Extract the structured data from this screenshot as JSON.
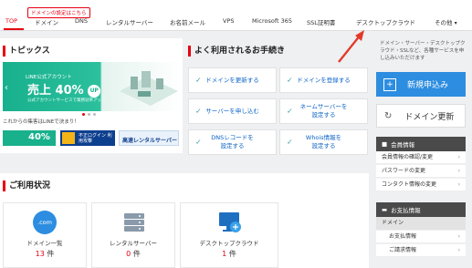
{
  "header": {
    "tooltip": "ドメインの設定はこちら",
    "nav": [
      {
        "label": "TOP"
      },
      {
        "label": "ドメイン"
      },
      {
        "label": "DNS"
      },
      {
        "label": "レンタルサーバー"
      },
      {
        "label": "お名前メール"
      },
      {
        "label": "VPS"
      },
      {
        "label": "Microsoft 365"
      },
      {
        "label": "SSL証明書"
      },
      {
        "label": "デスクトップクラウド"
      },
      {
        "label": "その他"
      }
    ],
    "active_index": 0
  },
  "topics": {
    "title": "トピックス",
    "banner": {
      "small": "LINE公式アカウント",
      "big_prefix": "売上",
      "big_value": "40%",
      "up": "UP",
      "sub": "公式アカウントサービスで業務効率アップ"
    },
    "caption": "これからの集客はLINEで決まり！",
    "mini_banners": [
      {
        "text": "40%"
      },
      {
        "text": "不正ログイン 利用攻撃"
      },
      {
        "text": "高速レンタルサーバー"
      }
    ]
  },
  "procedures": {
    "title": "よく利用されるお手続き",
    "items": [
      {
        "label": "ドメインを更新する"
      },
      {
        "label": "ドメインを登録する"
      },
      {
        "label": "サーバーを申し込む"
      },
      {
        "label": "ネームサーバーを\n設定する"
      },
      {
        "label": "DNSレコードを\n設定する"
      },
      {
        "label": "Whois情報を\n設定する"
      }
    ]
  },
  "usage": {
    "title": "ご利用状況",
    "cards": [
      {
        "label": "ドメイン一覧",
        "count": "13",
        "unit": "件",
        "icon": ".com"
      },
      {
        "label": "レンタルサーバー",
        "count": "0",
        "unit": "件",
        "icon": "server-icon"
      },
      {
        "label": "デスクトップクラウド",
        "count": "1",
        "unit": "件",
        "icon": "cloud-desktop-icon"
      }
    ]
  },
  "sidebar": {
    "description": "ドメイン・サーバー・デスクトップクラウド・SSLなど、各種サービスを申し込みいただけます",
    "new_button": "新規申込み",
    "renew_button": "ドメイン更新",
    "member_title": "会員情報",
    "member_links": [
      {
        "label": "会員情報の確認/変更"
      },
      {
        "label": "パスワードの変更"
      },
      {
        "label": "コンタクト情報の変更"
      }
    ],
    "payment_title": "お支払情報",
    "payment_sub": "ドメイン",
    "payment_links": [
      {
        "label": "お支払情報"
      },
      {
        "label": "ご請求情報"
      }
    ]
  },
  "colors": {
    "brand": "#e60012",
    "link": "#0b63c6",
    "primary_button": "#2d8de0"
  }
}
